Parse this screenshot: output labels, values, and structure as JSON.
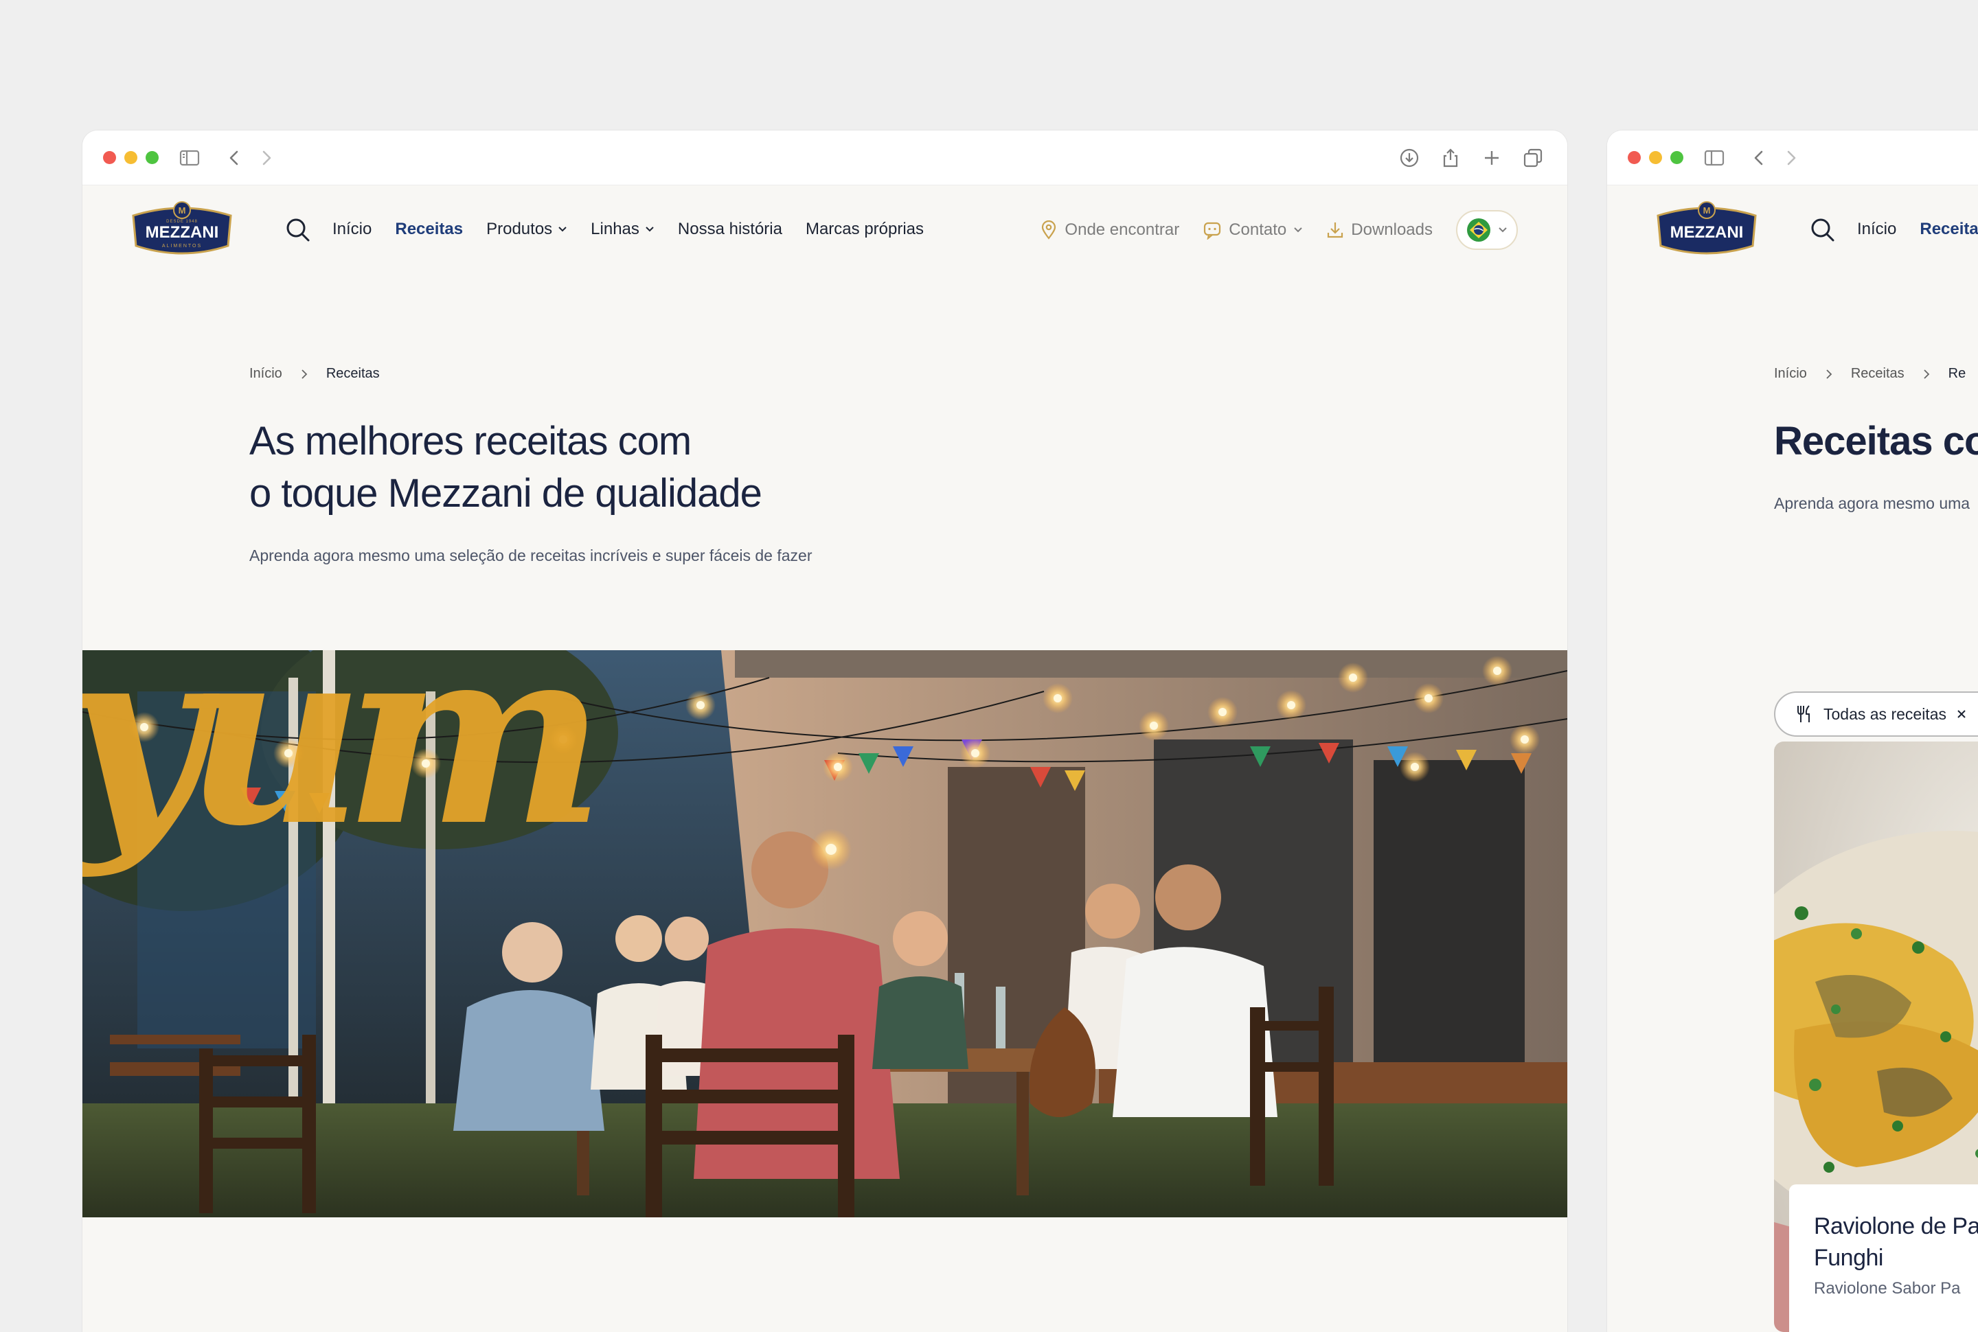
{
  "brand": {
    "name": "MEZZANI",
    "logo_top": "DESDE 1948",
    "logo_bottom": "ALIMENTOS"
  },
  "nav": {
    "items": [
      {
        "label": "Início",
        "active": false,
        "dropdown": false
      },
      {
        "label": "Receitas",
        "active": true,
        "dropdown": false
      },
      {
        "label": "Produtos",
        "active": false,
        "dropdown": true
      },
      {
        "label": "Linhas",
        "active": false,
        "dropdown": true
      },
      {
        "label": "Nossa história",
        "active": false,
        "dropdown": false
      },
      {
        "label": "Marcas próprias",
        "active": false,
        "dropdown": false
      }
    ]
  },
  "utilities": {
    "where": "Onde encontrar",
    "contact": "Contato",
    "downloads": "Downloads",
    "language_flag": "brazil-flag-icon"
  },
  "main": {
    "breadcrumb": [
      "Início",
      "Receitas"
    ],
    "title_line1": "As melhores receitas com",
    "title_line2": "o toque Mezzani de qualidade",
    "subtitle": "Aprenda agora mesmo uma seleção de receitas incríveis e super fáceis de fazer",
    "hero_script": "yum"
  },
  "side": {
    "nav": [
      "Início",
      "Receitas"
    ],
    "breadcrumb": [
      "Início",
      "Receitas",
      "Re"
    ],
    "title": "Receitas co",
    "subtitle": "Aprenda agora mesmo uma",
    "filter_label": "Todas as receitas",
    "recipe_title_line1": "Raviolone de Pa",
    "recipe_title_line2": "Funghi",
    "recipe_desc": "Raviolone Sabor Pa"
  },
  "colors": {
    "brand_blue": "#1f3d7a",
    "brand_navy": "#1a2b63",
    "accent_yellow": "#e3a32a",
    "page_bg": "#f8f7f4"
  }
}
